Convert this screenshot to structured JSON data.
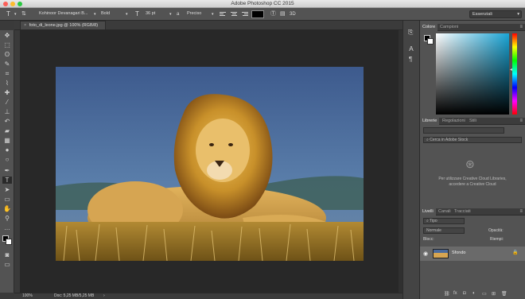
{
  "app": {
    "title": "Adobe Photoshop CC 2015",
    "workspace": "Essenziali"
  },
  "options_bar": {
    "type_tool_icon": "T",
    "font_family": "Kohinoor Devanagari B...",
    "font_style": "Bold",
    "size_icon": "T",
    "font_size": "36 pt",
    "aa_prefix": "a",
    "antialias": "Preciso",
    "color_label": "Colore"
  },
  "document": {
    "tab_title": "foto_di_leone.jpg @ 100% (RGB/8)",
    "zoom": "100%",
    "doc_info": "Doc: 5,25 MB/5,25 MB"
  },
  "color_panel": {
    "tabs": [
      "Colore",
      "Campioni"
    ]
  },
  "libraries_panel": {
    "tabs": [
      "Librerie",
      "Regolazioni",
      "Stili"
    ],
    "search_placeholder": "Cerca in Adobe Stock",
    "message_line1": "Per utilizzare Creative Cloud Libraries,",
    "message_line2": "accedere a Creative Cloud"
  },
  "layers_panel": {
    "tabs": [
      "Livelli",
      "Canali",
      "Tracciati"
    ],
    "kind_filter": "Tipo",
    "blend_mode": "Normale",
    "opacity_label": "Opacità:",
    "lock_label": "Blocc:",
    "fill_label": "Riempi:",
    "layers": [
      {
        "name": "Sfondo",
        "visible": true,
        "locked": true
      }
    ]
  },
  "colors": {
    "accent": "#2b86ec",
    "panel_bg": "#535353",
    "canvas_bg": "#282828"
  },
  "icons": {
    "toolbar": [
      "move-icon",
      "marquee-icon",
      "lasso-icon",
      "quick-select-icon",
      "crop-icon",
      "eyedropper-icon",
      "healing-icon",
      "brush-icon",
      "clone-stamp-icon",
      "history-brush-icon",
      "eraser-icon",
      "gradient-icon",
      "blur-icon",
      "dodge-icon",
      "pen-icon",
      "type-icon",
      "path-select-icon",
      "shape-icon",
      "hand-icon",
      "zoom-icon",
      "more-tools-icon"
    ]
  }
}
